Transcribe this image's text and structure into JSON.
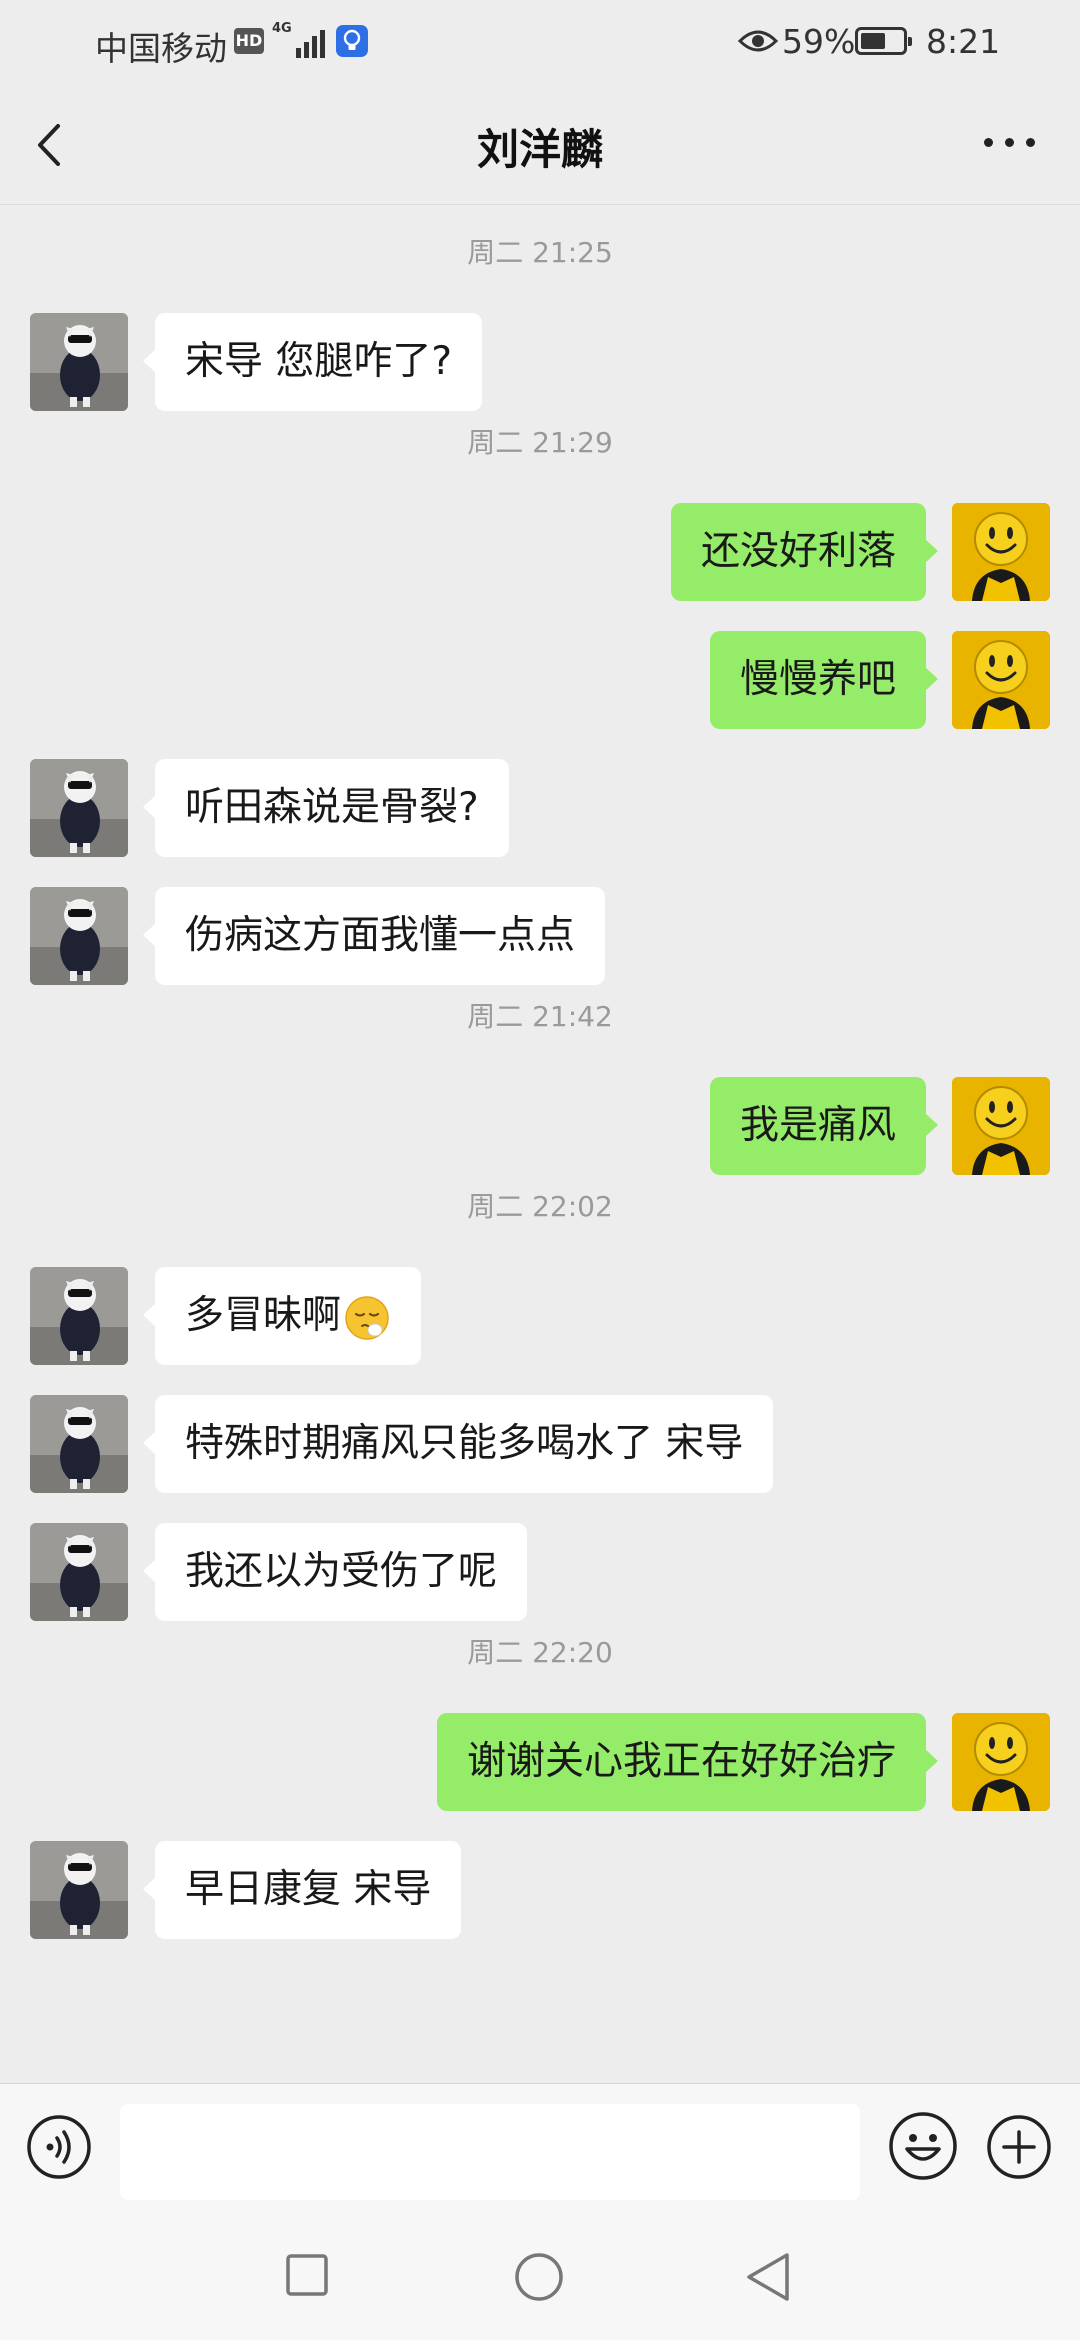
{
  "status_bar": {
    "carrier": "中国移动",
    "hd": "HD",
    "network": "4G",
    "battery_percent": "59%",
    "battery_level": 0.59,
    "time": "8:21"
  },
  "nav": {
    "title": "刘洋麟",
    "back_icon": "chevron-left-icon",
    "more_icon": "more-dots-icon"
  },
  "messages": [
    {
      "type": "timestamp",
      "text": "周二 21:25"
    },
    {
      "type": "message",
      "side": "left",
      "text": "宋导 您腿咋了?"
    },
    {
      "type": "timestamp",
      "text": "周二 21:29"
    },
    {
      "type": "message",
      "side": "right",
      "text": "还没好利落"
    },
    {
      "type": "message",
      "side": "right",
      "text": "慢慢养吧"
    },
    {
      "type": "message",
      "side": "left",
      "text": "听田森说是骨裂?"
    },
    {
      "type": "message",
      "side": "left",
      "text": "伤病这方面我懂一点点"
    },
    {
      "type": "timestamp",
      "text": "周二 21:42"
    },
    {
      "type": "message",
      "side": "right",
      "text": "我是痛风"
    },
    {
      "type": "timestamp",
      "text": "周二 22:02"
    },
    {
      "type": "message",
      "side": "left",
      "text": "多冒昧啊",
      "emoji": "sleepy-face-icon"
    },
    {
      "type": "message",
      "side": "left",
      "text": "特殊时期痛风只能多喝水了 宋导"
    },
    {
      "type": "message",
      "side": "left",
      "text": "我还以为受伤了呢"
    },
    {
      "type": "timestamp",
      "text": "周二 22:20"
    },
    {
      "type": "message",
      "side": "right",
      "text": "谢谢关心我正在好好治疗"
    },
    {
      "type": "message",
      "side": "left",
      "text": "早日康复 宋导"
    }
  ],
  "input_bar": {
    "voice_icon": "voice-icon",
    "text_value": "",
    "emoji_icon": "emoji-icon",
    "plus_icon": "plus-icon"
  },
  "colors": {
    "chat_background": "#ededed",
    "sent_bubble": "#95ec69",
    "received_bubble": "#ffffff",
    "timestamp_text": "#9a9a9a"
  }
}
